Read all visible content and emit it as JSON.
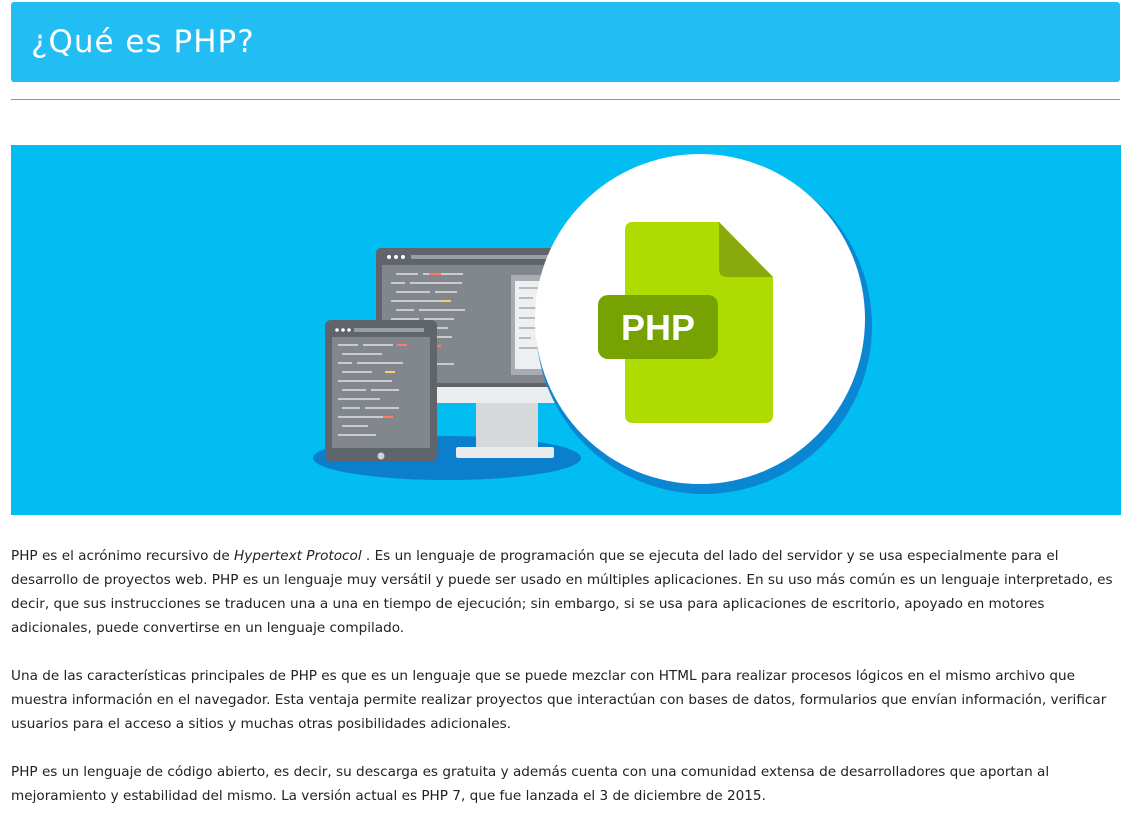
{
  "header": {
    "title": "¿Qué es PHP?"
  },
  "hero": {
    "badge_text": "PHP",
    "icons": [
      "monitor-icon",
      "tablet-icon",
      "php-file-icon"
    ],
    "colors": {
      "background": "#01bdf1",
      "file_green": "#aedc01",
      "file_fold": "#8aaa0b",
      "badge_green": "#77a302",
      "circle": "#ffffff",
      "device_gray": "#60646b"
    }
  },
  "article": {
    "p1_before": "PHP es el acrónimo recursivo de ",
    "p1_em": "Hypertext Protocol",
    "p1_after": " . Es un lenguaje de programación que se ejecuta del lado del servidor y se usa especialmente para el desarrollo de proyectos web. PHP es un lenguaje muy versátil y puede ser usado en múltiples aplicaciones. En su uso más común es un lenguaje interpretado, es decir, que sus instrucciones se traducen una a una en tiempo de ejecución; sin embargo, si se usa para aplicaciones de escritorio, apoyado en motores adicionales, puede convertirse en un lenguaje compilado.",
    "p2": "Una de las características principales de PHP es que es un lenguaje que se puede mezclar con HTML para realizar procesos lógicos en el mismo archivo que muestra información en el navegador. Esta ventaja permite realizar proyectos que interactúan con bases de datos, formularios que envían información, verificar usuarios para el acceso a sitios y muchas otras posibilidades adicionales.",
    "p3": "PHP es un lenguaje de código abierto, es decir, su descarga es gratuita y además cuenta con una comunidad extensa de desarrolladores que aportan al mejoramiento y estabilidad del mismo. La versión actual es PHP 7, que fue lanzada el 3 de diciembre de 2015."
  }
}
